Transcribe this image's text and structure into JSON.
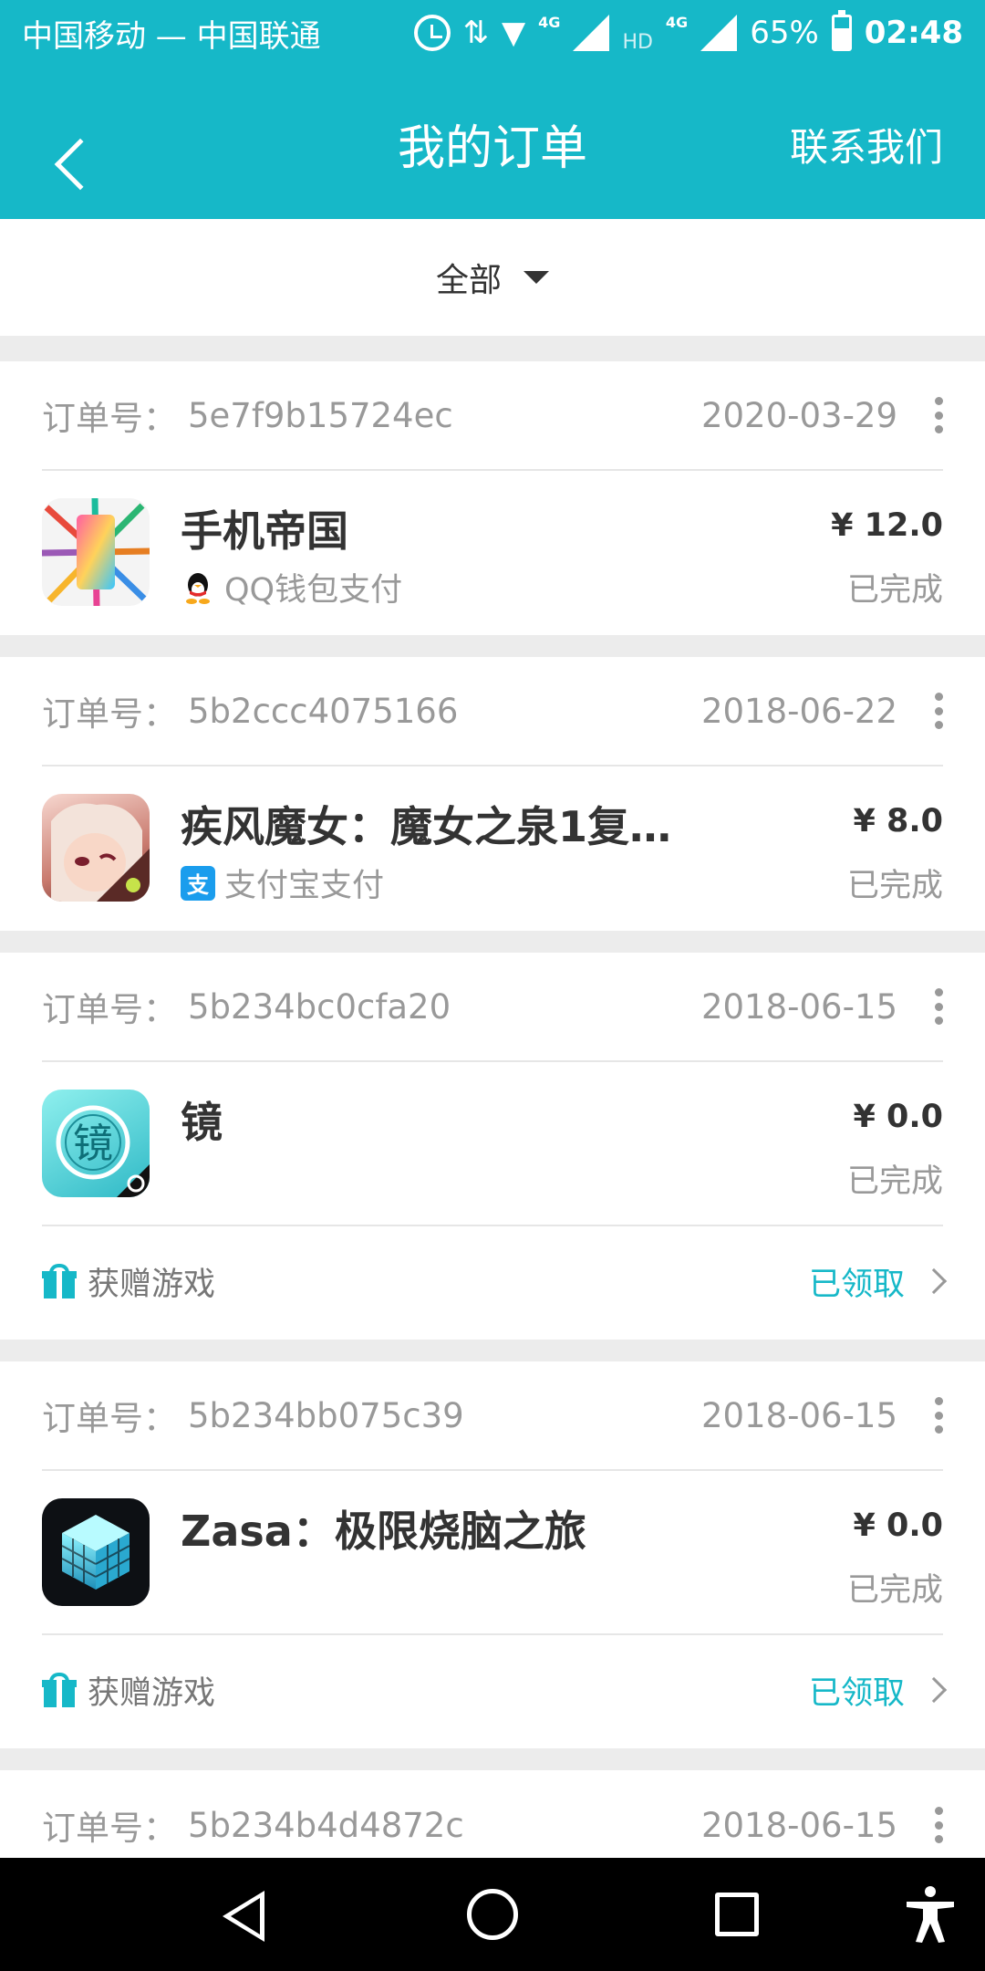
{
  "status_bar": {
    "carrier": "中国移动 — 中国联通",
    "net1": "4G",
    "hd": "HD",
    "net2": "4G",
    "battery": "65%",
    "time": "02:48"
  },
  "header": {
    "title": "我的订单",
    "contact": "联系我们"
  },
  "filter": {
    "selected": "全部"
  },
  "labels": {
    "order_no": "订单号：",
    "gift": "获赠游戏",
    "claimed": "已领取"
  },
  "orders": [
    {
      "id": "5e7f9b15724ec",
      "date": "2020-03-29",
      "app": "手机帝国",
      "payment": "QQ钱包支付",
      "price": "¥ 12.0",
      "status": "已完成",
      "icon": "phone-empire-icon"
    },
    {
      "id": "5b2ccc4075166",
      "date": "2018-06-22",
      "app": "疾风魔女：魔女之泉1复…",
      "payment": "支付宝支付",
      "price": "¥ 8.0",
      "status": "已完成",
      "icon": "witch-icon"
    },
    {
      "id": "5b234bc0cfa20",
      "date": "2018-06-15",
      "app": "镜",
      "price": "¥ 0.0",
      "status": "已完成",
      "icon": "mirror-icon",
      "gift": true
    },
    {
      "id": "5b234bb075c39",
      "date": "2018-06-15",
      "app": "Zasa：极限烧脑之旅",
      "price": "¥ 0.0",
      "status": "已完成",
      "icon": "zasa-cube-icon",
      "gift": true
    },
    {
      "id": "5b234b4d4872c",
      "date": "2018-06-15"
    }
  ],
  "colors": {
    "accent": "#16b8c8",
    "text_dark": "#333333",
    "text_muted": "#999999",
    "background": "#ececec"
  }
}
